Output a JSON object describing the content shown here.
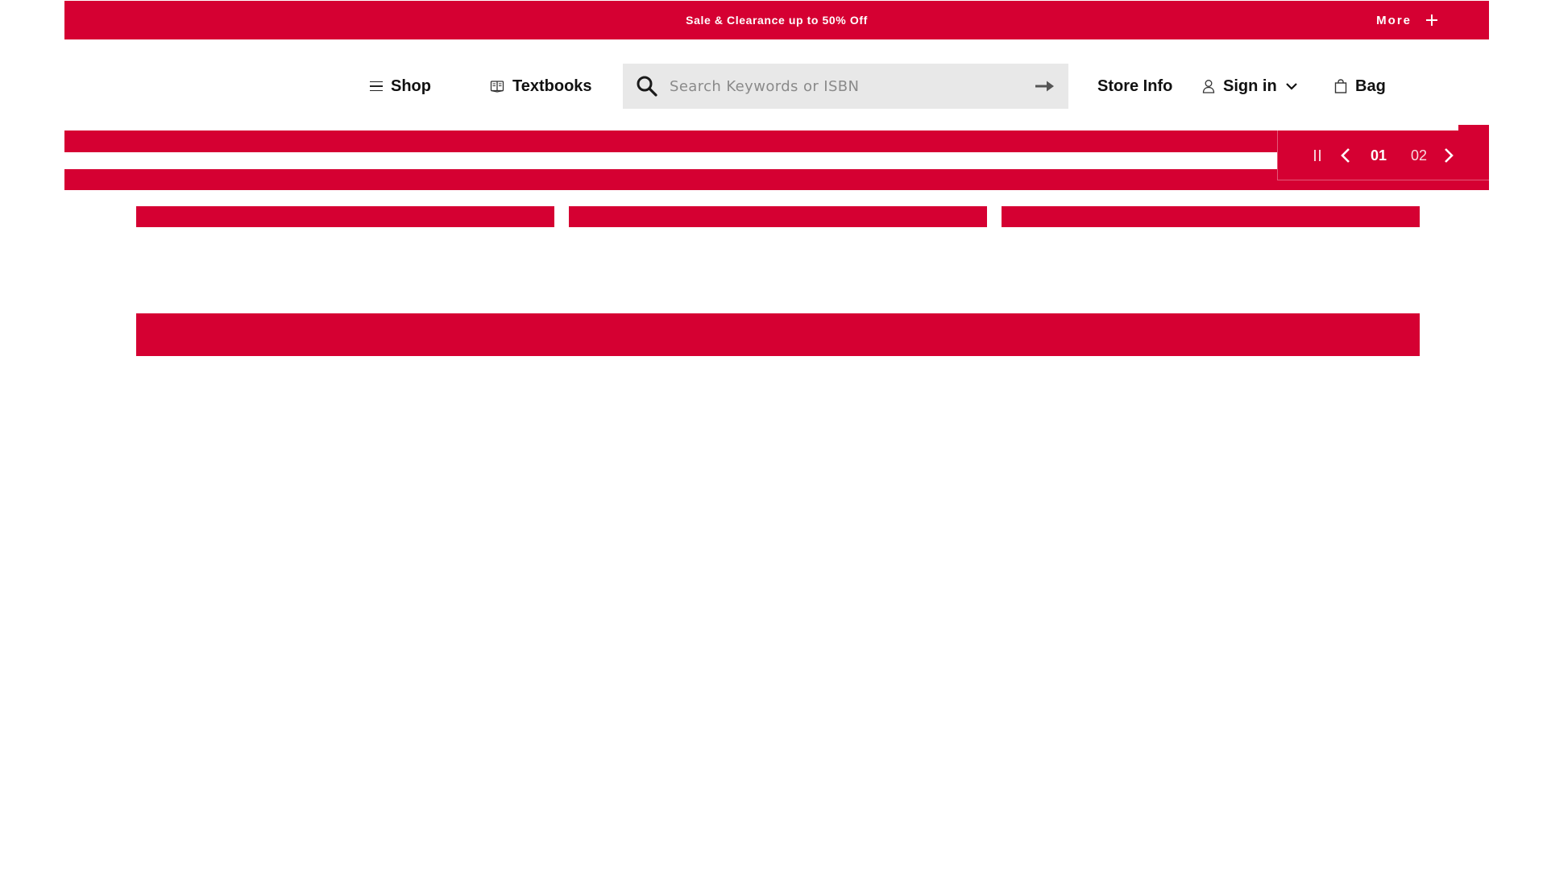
{
  "promo": {
    "text": "Sale & Clearance up to 50% Off",
    "more_label": "More"
  },
  "header": {
    "shop_label": "Shop",
    "textbooks_label": "Textbooks",
    "search_placeholder": "Search Keywords or ISBN",
    "search_value": "",
    "store_info_label": "Store Info",
    "sign_in_label": "Sign in",
    "bag_label": "Bag"
  },
  "carousel": {
    "current_page": "01",
    "next_page": "02"
  },
  "icons": {
    "shop": "hamburger-icon",
    "textbooks": "book-icon",
    "search": "search-icon",
    "submit": "arrow-right-icon",
    "sign_in": "user-icon",
    "sign_in_caret": "chevron-down-icon",
    "bag": "bag-icon",
    "more": "plus-icon",
    "pause": "pause-icon",
    "prev": "chevron-left-icon",
    "next": "chevron-right-icon"
  },
  "colors": {
    "brand_red": "#d50032",
    "search_bg": "#e8e8e8",
    "text": "#111111"
  }
}
